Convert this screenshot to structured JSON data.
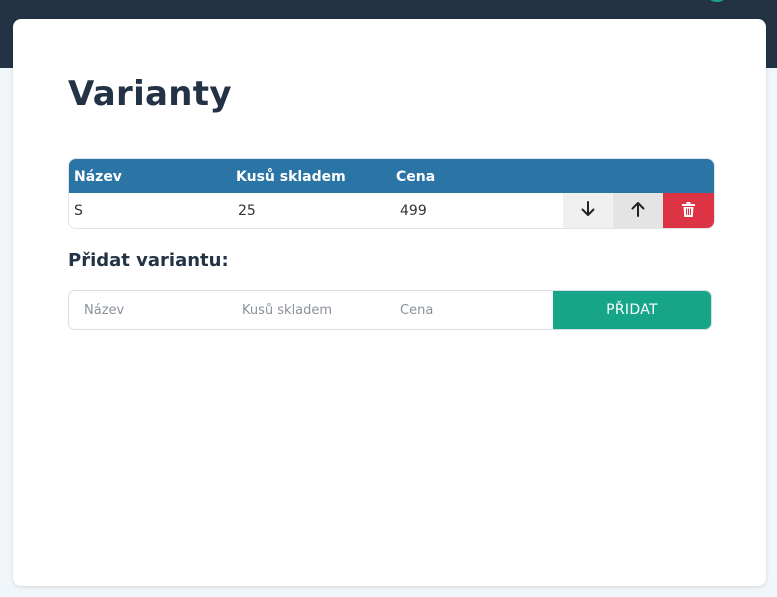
{
  "page": {
    "title": "Varianty"
  },
  "table": {
    "columns": [
      "Název",
      "Kusů skladem",
      "Cena"
    ],
    "rows": [
      {
        "name": "S",
        "stock": "25",
        "price": "499"
      }
    ],
    "actions": {
      "move_down_icon": "arrow-down-icon",
      "move_up_icon": "arrow-up-icon",
      "delete_icon": "trash-icon"
    }
  },
  "add_form": {
    "title": "Přidat variantu:",
    "name_placeholder": "Název",
    "stock_placeholder": "Kusů skladem",
    "price_placeholder": "Cena",
    "submit_label": "PŘIDAT"
  },
  "colors": {
    "topbar": "#233345",
    "table_header": "#2a75a6",
    "delete": "#dc3444",
    "accent": "#17a589"
  }
}
